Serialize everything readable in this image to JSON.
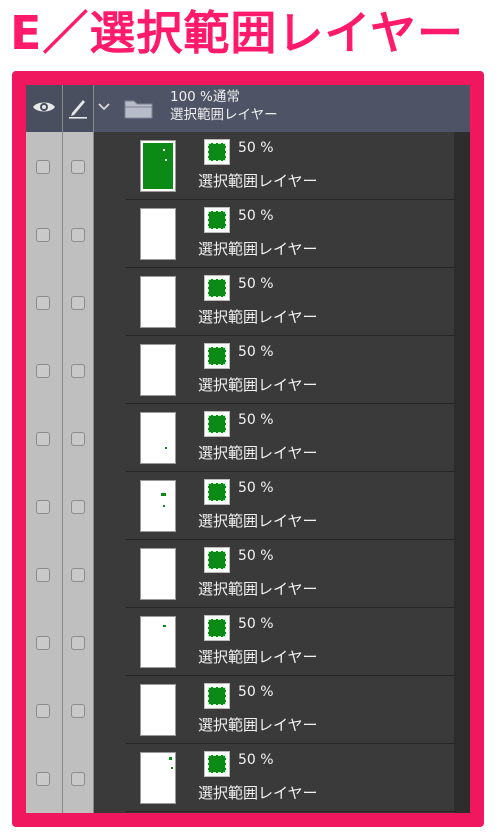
{
  "title": "E／選択範囲レイヤー",
  "colors": {
    "accent": "#f0175f",
    "mask_green": "#0b8a16",
    "panel_bg": "#3a3a3a",
    "header_bg": "#4e5466"
  },
  "header": {
    "expand_icon": "chevron-down-icon",
    "folder_icon": "folder-icon",
    "opacity_blend": "100 %通常",
    "folder_name": "選択範囲レイヤー",
    "eye_icon": "eye-icon",
    "pen_icon": "pen-icon"
  },
  "layers": [
    {
      "opacity": "50 %",
      "name": "選択範囲レイヤー"
    },
    {
      "opacity": "50 %",
      "name": "選択範囲レイヤー"
    },
    {
      "opacity": "50 %",
      "name": "選択範囲レイヤー"
    },
    {
      "opacity": "50 %",
      "name": "選択範囲レイヤー"
    },
    {
      "opacity": "50 %",
      "name": "選択範囲レイヤー"
    },
    {
      "opacity": "50 %",
      "name": "選択範囲レイヤー"
    },
    {
      "opacity": "50 %",
      "name": "選択範囲レイヤー"
    },
    {
      "opacity": "50 %",
      "name": "選択範囲レイヤー"
    },
    {
      "opacity": "50 %",
      "name": "選択範囲レイヤー"
    },
    {
      "opacity": "50 %",
      "name": "選択範囲レイヤー"
    }
  ]
}
